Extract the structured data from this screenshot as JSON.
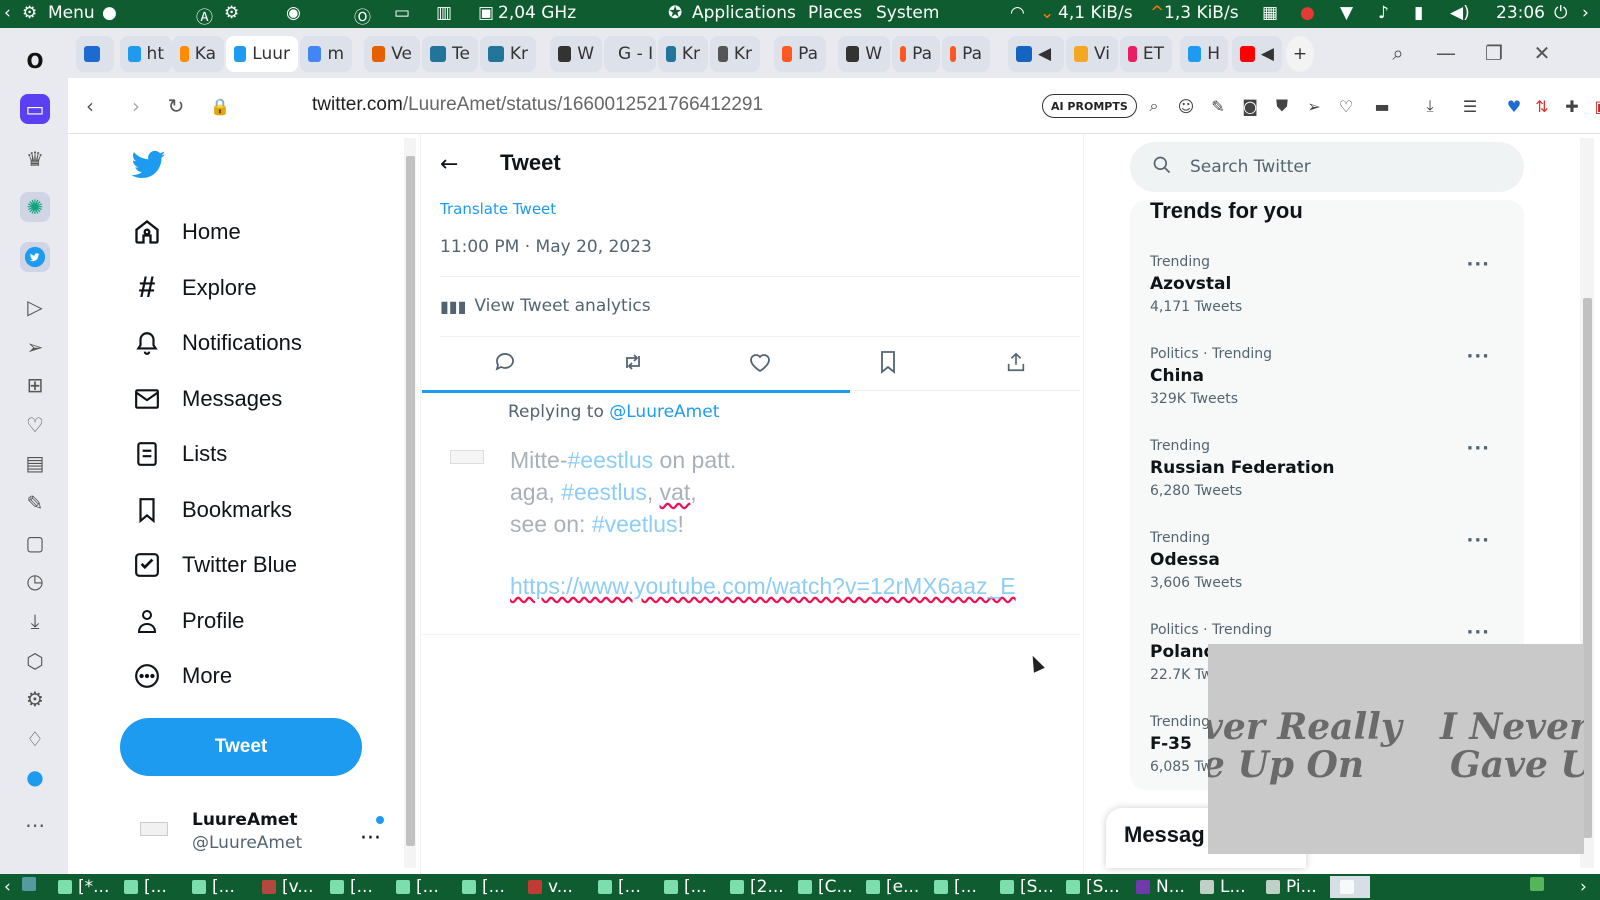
{
  "system_panel": {
    "menu_label": "Menu",
    "cpu": "2,04 GHz",
    "applications": "Applications",
    "places": "Places",
    "system": "System",
    "net_down": "4,1 KiB/s",
    "net_up": "1,3 KiB/s",
    "clock": "23:06"
  },
  "tabs": [
    {
      "label": "ht",
      "color": "#1d9bf0"
    },
    {
      "label": "Ka",
      "color": "#ff8c00"
    },
    {
      "label": "Luur",
      "color": "#1d9bf0",
      "active": true
    },
    {
      "label": "m",
      "color": "#4285f4"
    },
    {
      "label": "Ve",
      "color": "#e66000"
    },
    {
      "label": "Te",
      "color": "#21759b"
    },
    {
      "label": "Kr",
      "color": "#21759b"
    },
    {
      "label": "W",
      "color": "#333333"
    },
    {
      "label": "G - I",
      "color": "#4285f4"
    },
    {
      "label": "Kr",
      "color": "#21759b"
    },
    {
      "label": "Kr",
      "color": "#555555"
    },
    {
      "label": "Pa",
      "color": "#ff5722"
    },
    {
      "label": "W",
      "color": "#333333"
    },
    {
      "label": "Pa",
      "color": "#ff5722"
    },
    {
      "label": "Pa",
      "color": "#ff5722"
    },
    {
      "label": "Vi",
      "color": "#f5a623"
    },
    {
      "label": "ET",
      "color": "#e91e63"
    },
    {
      "label": "H",
      "color": "#1d9bf0"
    }
  ],
  "address": {
    "host": "twitter.com",
    "path": "/LuureAmet/status/1660012521766412291",
    "ai_prompts": "AI PROMPTS"
  },
  "nav": {
    "home": "Home",
    "explore": "Explore",
    "notifications": "Notifications",
    "messages": "Messages",
    "lists": "Lists",
    "bookmarks": "Bookmarks",
    "twitter_blue": "Twitter Blue",
    "profile": "Profile",
    "more": "More",
    "tweet_button": "Tweet"
  },
  "account": {
    "name": "LuureAmet",
    "handle": "@LuureAmet"
  },
  "tweet": {
    "header_title": "Tweet",
    "translate": "Translate Tweet",
    "timestamp": "11:00 PM · May 20, 2023",
    "analytics": "View Tweet analytics",
    "replying_prefix": "Replying to",
    "replying_handle": "@LuureAmet",
    "composer": {
      "line1_pre": "Mitte-",
      "line1_tag": "#eestlus",
      "line1_post": " on patt.",
      "line2_pre": "aga, ",
      "line2_tag": "#eestlus",
      "line2_mid": ", ",
      "line2_word": "vat",
      "line2_post": ",",
      "line3_pre": "see on: ",
      "line3_tag": "#veetlus",
      "line3_post": "!",
      "link": "https://www.youtube.com/watch?v=12rMX6aaz_E"
    }
  },
  "sidebar_right": {
    "search_placeholder": "Search Twitter",
    "trends_title": "Trends for you",
    "trends": [
      {
        "meta": "Trending",
        "name": "Azovstal",
        "count": "4,171 Tweets"
      },
      {
        "meta": "Politics · Trending",
        "name": "China",
        "count": "329K Tweets"
      },
      {
        "meta": "Trending",
        "name": "Russian Federation",
        "count": "6,280 Tweets"
      },
      {
        "meta": "Trending",
        "name": "Odessa",
        "count": "3,606 Tweets"
      },
      {
        "meta": "Politics · Trending",
        "name": "Poland",
        "count": "22.7K Tw"
      },
      {
        "meta": "Trending",
        "name": "F-35",
        "count": "6,085 Tw"
      }
    ],
    "messages_drawer": "Messag"
  },
  "video_overlay": {
    "line1_a": "ver Really",
    "line1_b": "I Never R",
    "line2_a": "e Up On",
    "line2_b": "Gave Up"
  },
  "taskbar": [
    {
      "label": "[*..."
    },
    {
      "label": "[..."
    },
    {
      "label": "[..."
    },
    {
      "label": "[v..."
    },
    {
      "label": "[..."
    },
    {
      "label": "[..."
    },
    {
      "label": "[..."
    },
    {
      "label": "v..."
    },
    {
      "label": "[..."
    },
    {
      "label": "[..."
    },
    {
      "label": "[2..."
    },
    {
      "label": "[C..."
    },
    {
      "label": "[e..."
    },
    {
      "label": "[..."
    },
    {
      "label": "[S..."
    },
    {
      "label": "[S..."
    },
    {
      "label": "N..."
    },
    {
      "label": "L..."
    },
    {
      "label": "Pi..."
    }
  ],
  "colors": {
    "twitter_blue": "#1d9bf0",
    "panel_green": "#0e5c2f",
    "text_primary": "#0f1419",
    "text_secondary": "#536471"
  }
}
